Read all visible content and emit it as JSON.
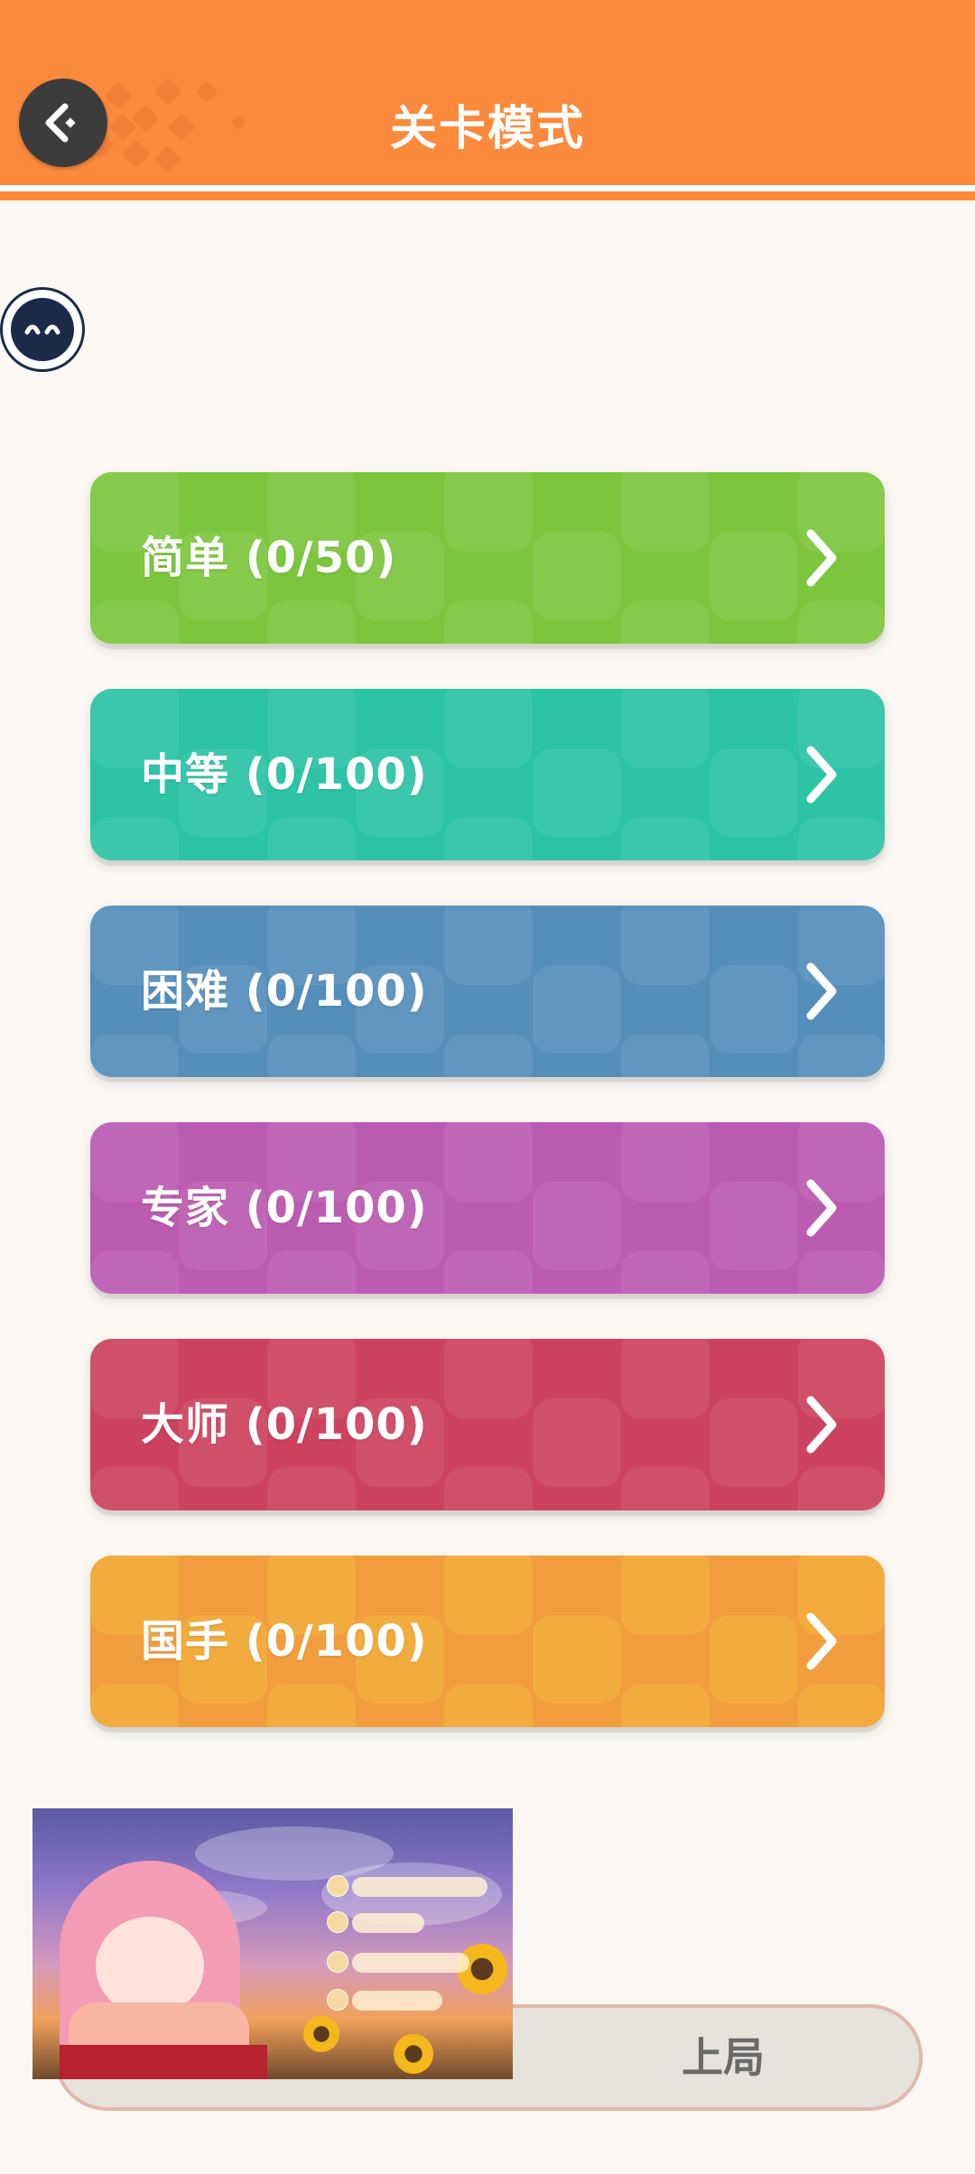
{
  "header": {
    "title": "关卡模式",
    "color": "#fb8a3c"
  },
  "levels": [
    {
      "label": "简单 (0/50)",
      "color": "#7cc63d"
    },
    {
      "label": "中等 (0/100)",
      "color": "#2dc3a5"
    },
    {
      "label": "困难 (0/100)",
      "color": "#548ebb"
    },
    {
      "label": "专家 (0/100)",
      "color": "#bb5cb1"
    },
    {
      "label": "大师 (0/100)",
      "color": "#cd435f"
    },
    {
      "label": "国手 (0/100)",
      "color": "#f29d3e"
    }
  ],
  "continue_button": {
    "visible_label": "上局"
  }
}
